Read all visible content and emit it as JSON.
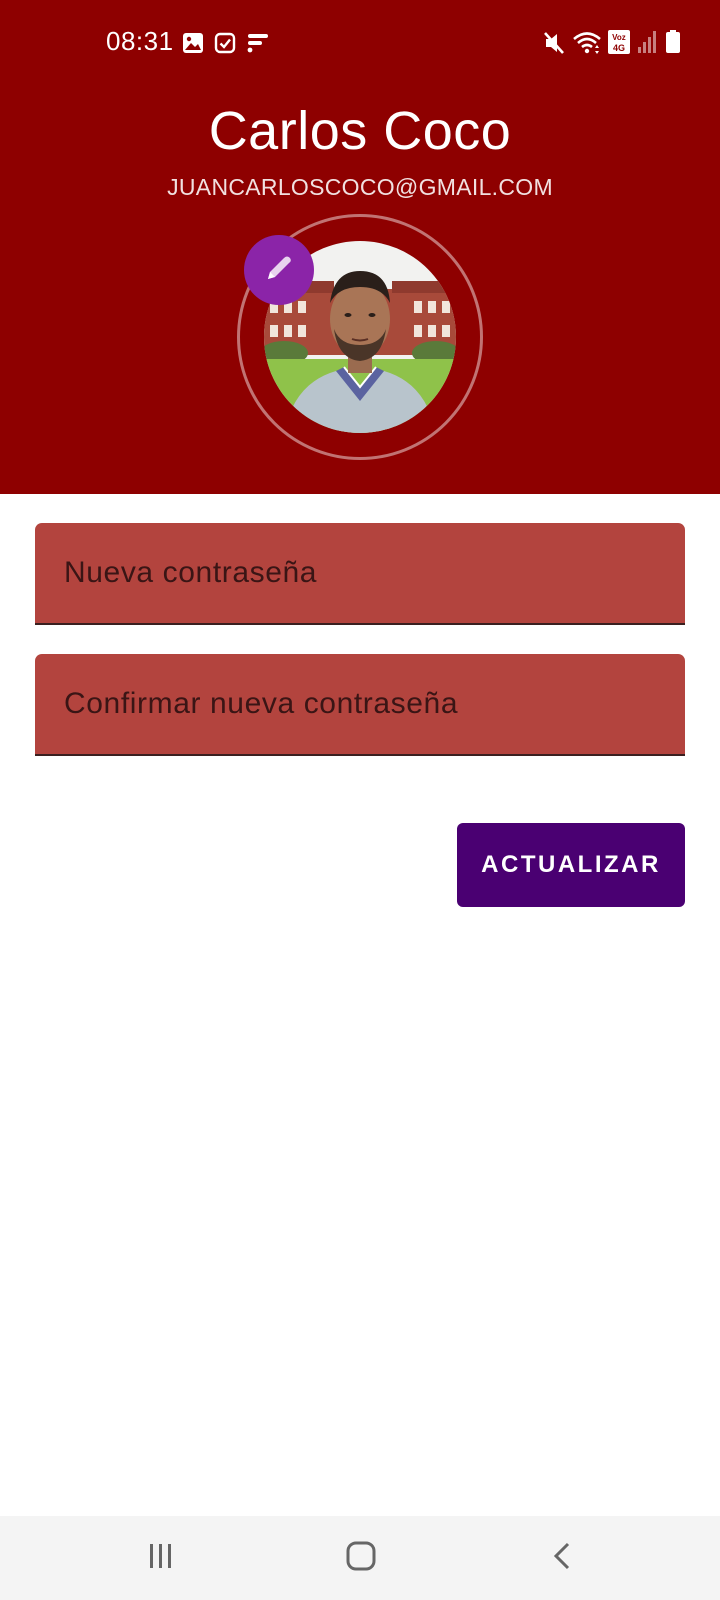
{
  "status_bar": {
    "time": "08:31",
    "left_icons": [
      "image-icon",
      "check-square-icon",
      "feed-icon"
    ],
    "right_icons": [
      "mute-icon",
      "wifi-icon",
      "volte-icon",
      "signal-icon",
      "battery-icon"
    ],
    "volte_label": "Voz 4G"
  },
  "profile": {
    "name": "Carlos Coco",
    "email": "JUANCARLOSCOCO@GMAIL.COM",
    "avatar_alt": "profile photo",
    "edit_icon": "pencil-icon"
  },
  "form": {
    "new_password_placeholder": "Nueva contraseña",
    "confirm_password_placeholder": "Confirmar nueva contraseña",
    "new_password_value": "",
    "confirm_password_value": ""
  },
  "actions": {
    "update_label": "ACTUALIZAR"
  },
  "nav_bar": {
    "items": [
      "recents-icon",
      "home-icon",
      "back-icon"
    ]
  },
  "colors": {
    "header": "#8e0000",
    "field_fill": "#b3443e",
    "button": "#4a0072",
    "fab": "#8b24a8"
  }
}
